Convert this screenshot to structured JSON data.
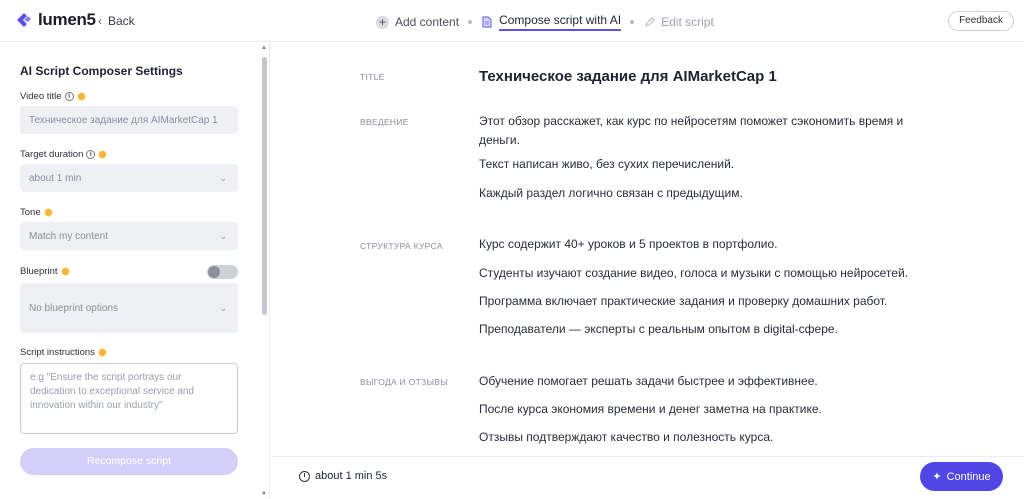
{
  "header": {
    "logo_text": "lumen5",
    "back_label": "Back",
    "steps": [
      {
        "label": "Add content",
        "icon": "plus-circle-icon"
      },
      {
        "label": "Compose script with AI",
        "icon": "document-icon"
      },
      {
        "label": "Edit script",
        "icon": "pencil-icon"
      }
    ],
    "feedback_label": "Feedback",
    "accent_color": "#5b52e6"
  },
  "settings": {
    "panel_title": "AI Script Composer Settings",
    "video_title_label": "Video title",
    "video_title_value": "Техническое задание для AIMarketCap 1",
    "target_duration_label": "Target duration",
    "target_duration_value": "about 1 min",
    "tone_label": "Tone",
    "tone_value": "Match my content",
    "blueprint_label": "Blueprint",
    "blueprint_enabled": false,
    "blueprint_value": "No blueprint options",
    "script_instructions_label": "Script instructions",
    "script_instructions_placeholder": "e.g \"Ensure the script portrays our dedication to exceptional service and innovation within our industry\"",
    "recompose_label": "Recompose script"
  },
  "script": {
    "title_label": "TITLE",
    "title": "Техническое задание для AIMarketCap 1",
    "sections": [
      {
        "label": "ВВЕДЕНИЕ",
        "paragraphs": [
          "Этот обзор расскажет, как курс по нейросетям поможет сэкономить время и деньги.",
          "Текст написан живо, без сухих перечислений.",
          "Каждый раздел логично связан с предыдущим."
        ]
      },
      {
        "label": "СТРУКТУРА КУРСА",
        "paragraphs": [
          "Курс содержит 40+ уроков и 5 проектов в портфолио.",
          "Студенты изучают создание видео, голоса и музыки с помощью нейросетей.",
          "Программа включает практические задания и проверку домашних работ.",
          "Преподаватели — эксперты с реальным опытом в digital-сфере."
        ]
      },
      {
        "label": "ВЫГОДА И ОТЗЫВЫ",
        "paragraphs": [
          "Обучение помогает решать задачи быстрее и эффективнее.",
          "После курса экономия времени и денег заметна на практике.",
          "Отзывы подтверждают качество и полезность курса."
        ]
      }
    ]
  },
  "footer": {
    "duration": "about 1 min 5s",
    "continue_label": "Continue",
    "continue_color": "#5046e5"
  }
}
